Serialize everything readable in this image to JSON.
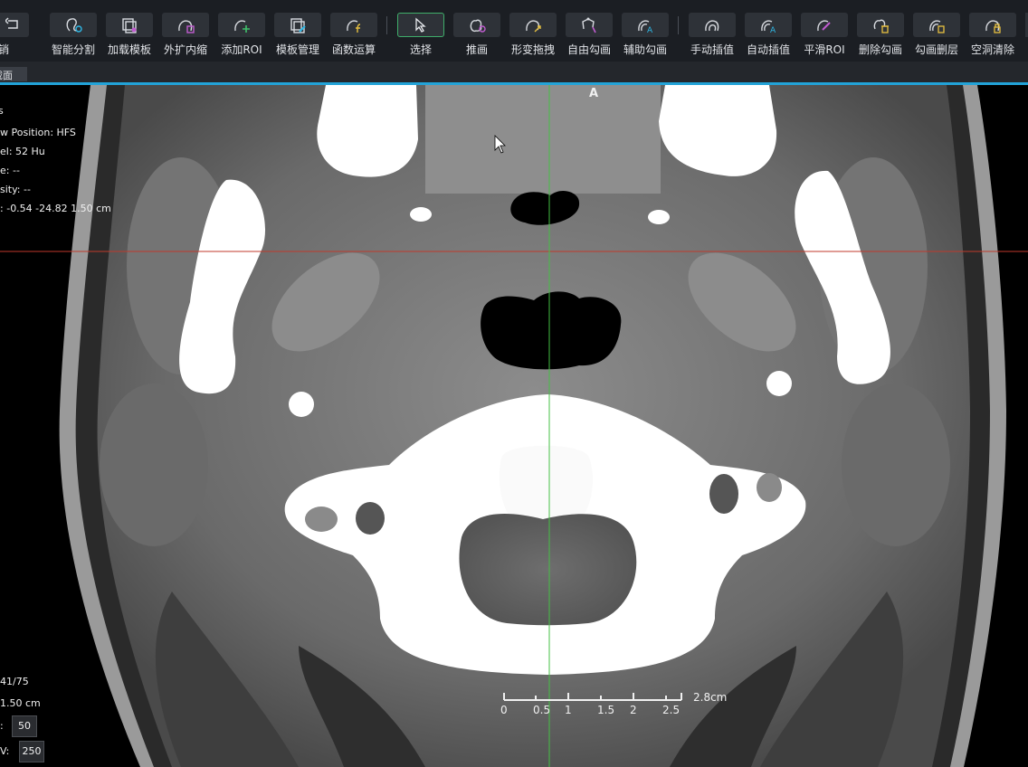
{
  "toolbar": {
    "tools": [
      {
        "id": "undo",
        "label": "撤销",
        "icon": "undo-icon",
        "active": false
      },
      {
        "id": "smart-seg",
        "label": "智能分割",
        "icon": "smart-segment-icon",
        "active": false
      },
      {
        "id": "load-template",
        "label": "加载模板",
        "icon": "load-template-icon",
        "active": false
      },
      {
        "id": "expand-shrink",
        "label": "外扩内缩",
        "icon": "expand-shrink-icon",
        "active": false
      },
      {
        "id": "add-roi",
        "label": "添加ROI",
        "icon": "add-roi-icon",
        "active": false
      },
      {
        "id": "template-manage",
        "label": "模板管理",
        "icon": "template-manage-icon",
        "active": false
      },
      {
        "id": "function-op",
        "label": "函数运算",
        "icon": "function-op-icon",
        "active": false
      },
      {
        "id": "select",
        "label": "选择",
        "icon": "select-arrow-icon",
        "active": true
      },
      {
        "id": "push",
        "label": "推画",
        "icon": "push-draw-icon",
        "active": false
      },
      {
        "id": "deform-drag",
        "label": "形变拖拽",
        "icon": "deform-drag-icon",
        "active": false
      },
      {
        "id": "free-draw",
        "label": "自由勾画",
        "icon": "free-draw-icon",
        "active": false
      },
      {
        "id": "assist-draw",
        "label": "辅助勾画",
        "icon": "assist-draw-icon",
        "active": false
      },
      {
        "id": "manual-interp",
        "label": "手动插值",
        "icon": "manual-interp-icon",
        "active": false
      },
      {
        "id": "auto-interp",
        "label": "自动插值",
        "icon": "auto-interp-icon",
        "active": false
      },
      {
        "id": "smooth-roi",
        "label": "平滑ROI",
        "icon": "smooth-roi-icon",
        "active": false
      },
      {
        "id": "delete-contour",
        "label": "删除勾画",
        "icon": "delete-contour-icon",
        "active": false
      },
      {
        "id": "delete-layer",
        "label": "勾画删层",
        "icon": "delete-layer-icon",
        "active": false
      },
      {
        "id": "clear-holes",
        "label": "空洞清除",
        "icon": "clear-holes-icon",
        "active": false
      }
    ]
  },
  "tab": {
    "label": "截面"
  },
  "overlay": {
    "patient_pos_label": "w Position:",
    "patient_pos_value": "HFS",
    "pixel_label": "el:",
    "pixel_value": "52 Hu",
    "line2_label": "e:",
    "line2_value": "--",
    "density_label": "sity:",
    "density_value": "--",
    "coords_label": ":",
    "coords_value": "-0.54 -24.82 1.50 cm",
    "top_left_char": "s",
    "direction_label": "A",
    "slice_index": "41/75",
    "slice_thickness": "1.50 cm",
    "wl_label": ":",
    "wl_value": "50",
    "ww_label": "V:",
    "ww_value": "250"
  },
  "scale_bar": {
    "ticks": [
      "0",
      "0.5",
      "1",
      "1.5",
      "2",
      "2.5"
    ],
    "unit_label": "2.8cm"
  },
  "colors": {
    "toolbar_bg": "#1b1e23",
    "accent": "#22a3d8",
    "active_border": "#3fae6a",
    "crosshair_vertical": "#45c045",
    "crosshair_horizontal": "#c0392b"
  }
}
